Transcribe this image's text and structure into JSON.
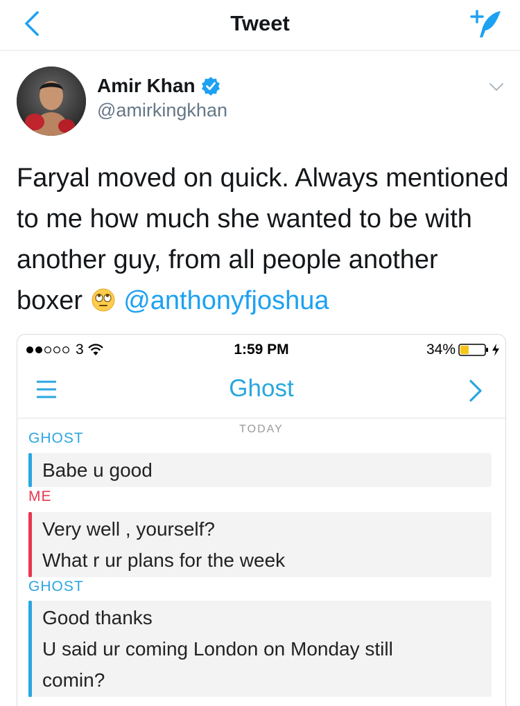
{
  "nav": {
    "title": "Tweet",
    "back_icon": "chevron-left-icon",
    "compose_icon": "compose-tweet-icon",
    "accent_color": "#1da1f2"
  },
  "tweet": {
    "author": {
      "name": "Amir Khan",
      "handle": "@amirkingkhan",
      "verified": true
    },
    "text_before_emoji": "Faryal moved on quick. Always mentioned to me how much she wanted to be with another guy, from all people another boxer",
    "emoji": "face-with-rolling-eyes-icon",
    "mention": "@anthonyfjoshua"
  },
  "screenshot": {
    "status_bar": {
      "carrier": "3",
      "time": "1:59 PM",
      "battery": "34%"
    },
    "chat_title": "Ghost",
    "day_label": "TODAY",
    "messages": [
      {
        "sender": "GHOST",
        "lines": [
          "Babe u good"
        ]
      },
      {
        "sender": "ME",
        "lines": [
          "Very well , yourself?",
          "What r ur plans for the week"
        ]
      },
      {
        "sender": "GHOST",
        "lines": [
          "Good thanks",
          "U said ur coming London on Monday still",
          "comin?"
        ]
      }
    ],
    "colors": {
      "ghost": "#2aa6e0",
      "me": "#e8364f",
      "bubble": "#f3f3f3"
    }
  }
}
